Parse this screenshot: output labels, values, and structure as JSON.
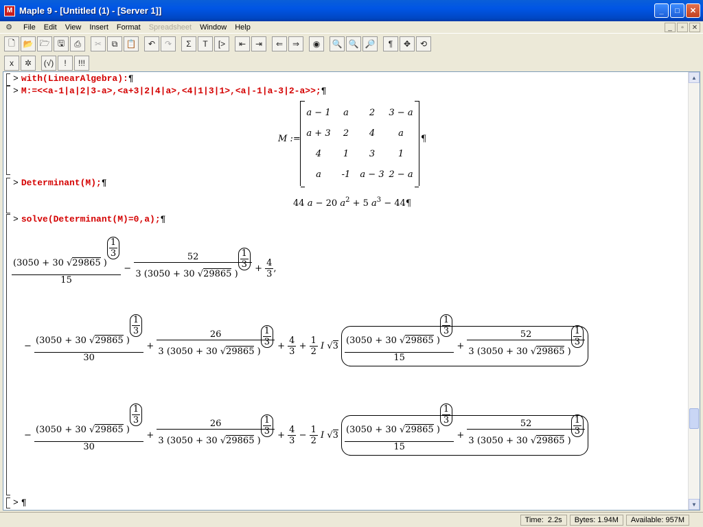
{
  "window": {
    "title": "Maple 9  - [Untitled (1) - [Server 1]]",
    "app_icon_glyph": "M",
    "buttons": [
      "_",
      "□",
      "✕"
    ]
  },
  "menu": {
    "items": [
      {
        "label": "File",
        "enabled": true
      },
      {
        "label": "Edit",
        "enabled": true
      },
      {
        "label": "View",
        "enabled": true
      },
      {
        "label": "Insert",
        "enabled": true
      },
      {
        "label": "Format",
        "enabled": true
      },
      {
        "label": "Spreadsheet",
        "enabled": false
      },
      {
        "label": "Window",
        "enabled": true
      },
      {
        "label": "Help",
        "enabled": true
      }
    ],
    "mdi_buttons": [
      "_",
      "▫",
      "✕"
    ]
  },
  "toolbar": {
    "row1": [
      {
        "icon": "new-file-icon",
        "glyph": "🗋"
      },
      {
        "icon": "open-file-icon",
        "glyph": "📂"
      },
      {
        "icon": "open-url-icon",
        "glyph": "🗁"
      },
      {
        "icon": "save-icon",
        "glyph": "🖫"
      },
      {
        "icon": "print-icon",
        "glyph": "⎙"
      },
      {
        "icon": "cut-icon",
        "glyph": "✂",
        "disabled": true
      },
      {
        "icon": "copy-icon",
        "glyph": "⧉"
      },
      {
        "icon": "paste-icon",
        "glyph": "📋"
      },
      {
        "icon": "undo-icon",
        "glyph": "↶"
      },
      {
        "icon": "redo-icon",
        "glyph": "↷",
        "disabled": true
      },
      {
        "icon": "math-input-icon",
        "glyph": "Σ"
      },
      {
        "icon": "text-input-icon",
        "glyph": "T"
      },
      {
        "icon": "insert-prompt-icon",
        "glyph": "[>"
      },
      {
        "icon": "outdent-icon",
        "glyph": "⇤"
      },
      {
        "icon": "indent-icon",
        "glyph": "⇥"
      },
      {
        "icon": "back-icon",
        "glyph": "⇐"
      },
      {
        "icon": "forward-icon",
        "glyph": "⇒"
      },
      {
        "icon": "stop-icon",
        "glyph": "◉"
      },
      {
        "icon": "zoom-100-icon",
        "glyph": "🔍"
      },
      {
        "icon": "zoom-150-icon",
        "glyph": "🔍"
      },
      {
        "icon": "zoom-200-icon",
        "glyph": "🔎"
      },
      {
        "icon": "pilcrow-icon",
        "glyph": "¶"
      },
      {
        "icon": "expand-icon",
        "glyph": "✥"
      },
      {
        "icon": "restart-icon",
        "glyph": "⟲"
      }
    ],
    "row2": [
      {
        "icon": "stop-execution-icon",
        "glyph": "x"
      },
      {
        "icon": "debug-icon",
        "glyph": "✲"
      },
      {
        "icon": "check-syntax-icon",
        "glyph": "(√)"
      },
      {
        "icon": "execute-icon",
        "glyph": "!"
      },
      {
        "icon": "execute-all-icon",
        "glyph": "!!!"
      }
    ]
  },
  "worksheet": {
    "prompt": ">",
    "pilcrow": "¶",
    "commands": [
      "with(LinearAlgebra):",
      "M:=<<a-1|a|2|3-a>,<a+3|2|4|a>,<4|1|3|1>,<a|-1|a-3|2-a>>;",
      "Determinant(M);",
      "solve(Determinant(M)=0,a);"
    ],
    "matrix_label": "M :=",
    "matrix": [
      [
        "a − 1",
        "a",
        "2",
        "3 − a"
      ],
      [
        "a + 3",
        "2",
        "4",
        "a"
      ],
      [
        "4",
        "1",
        "3",
        "1"
      ],
      [
        "a",
        "-1",
        "a − 3",
        "2 − a"
      ]
    ],
    "determinant": {
      "t1": "44",
      "v": "a",
      "t2": "− 20",
      "e2": "2",
      "t3": "+ 5",
      "e3": "3",
      "t4": "− 44"
    },
    "solution": {
      "base": "(3050 + 30",
      "sqrt_arg": "29865",
      "close": ")",
      "exp_num": "1",
      "exp_den": "3",
      "den15": "15",
      "den30": "30",
      "num52": "52",
      "num26": "26",
      "den3": "3",
      "four": "4",
      "three": "3",
      "half_num": "1",
      "half_den": "2",
      "I": "I",
      "sqrt3": "3",
      "minus": "−",
      "plus": "+",
      "comma": ","
    }
  },
  "status": {
    "time_label": "Time:",
    "time": "2.2s",
    "bytes_label": "Bytes:",
    "bytes": "1.94M",
    "available_label": "Available:",
    "available": "957M"
  }
}
